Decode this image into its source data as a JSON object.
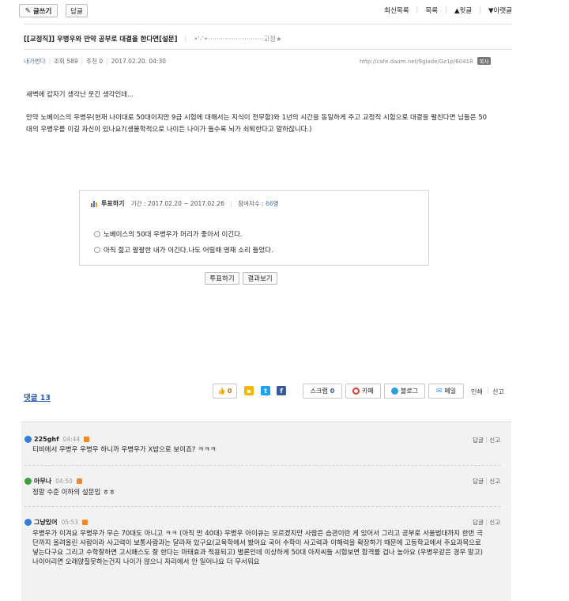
{
  "toolbar": {
    "write_label": "글쓰기",
    "reply_label": "답글"
  },
  "nav": {
    "latest": "최신목록",
    "list": "목록",
    "prev": "▲윗글",
    "next": "▼아랫글"
  },
  "post": {
    "title": "[[교정직]] 우병우와 만약 공부로 대결을 한다면[설문]",
    "title_deco": "•'-'•··························교정★",
    "author": "내가쩐다",
    "views": "조회 589",
    "recommend": "추천 0",
    "date": "2017.02.20. 04:30",
    "url": "http://cafe.daum.net/9glade/Gz1p/60418",
    "copy_label": "복사",
    "body_line1": "새벽에 갑자기 생각난 웃긴 생각인데...",
    "body_para2": "만약 노베이스의 우병우(현재 나이대로 50대이지만 9급 시험에 대해서는 지식이 전무함)와 1년의 시간을 동일하게 주고 교정직 시험으로 대결을 펼친다면 님들은 50대의 우병우를 이길 자신이 있나요?(생물학적으로 나이든 나이가 들수록 뇌가 쇠퇴한다고 말하잖니다.)"
  },
  "poll": {
    "title": "투표하기",
    "period": "기간 : 2017.02.20 ~ 2017.02.26",
    "participants_label": "참여자수 :",
    "participants": "66",
    "participants_unit": "명",
    "options": [
      "노베이스의 50대 우병우가 머리가 좋아서 이긴다.",
      "아직 젊고 팔팔한 내가 이긴다.나도 어릴때 영재 소리 들었다."
    ],
    "vote_button": "투표하기",
    "result_button": "결과보기"
  },
  "comments_header": "댓글 13",
  "share": {
    "like_count": "0",
    "scrap_label": "스크랩",
    "scrap_count": "0",
    "cafe_label": "카페",
    "blog_label": "블로그",
    "mail_label": "메일",
    "print_label": "인쇄",
    "report_label": "신고"
  },
  "comments": [
    {
      "author": "225ghf",
      "time": "04:44",
      "text": "티비에서 우병우 우병우 하니까 우병우가 X밥으로 보이죠? ㅋㅋㅋ",
      "reply": "답글",
      "report": "신고",
      "icon_color": "#2f7fd6"
    },
    {
      "author": "아무나",
      "time": "04:50",
      "text": "정말 수준 이하의 설문임 ㅎㅎ",
      "reply": "답글",
      "report": "신고",
      "icon_color": "#3aa23a"
    },
    {
      "author": "그냥있어",
      "time": "05:53",
      "text": "우병우가 이겨요 우병우가 무슨 70대도 아니고 ㅋㅋ (아직 만 40대) 우병우 아이큐는 모르겠지만 사람은 습관이란 게 있어서 그리고 공부로 서울법대까지 한번 극단까지 올려올린 사람이라 사고력이 보통사람과는 달라져 있구요(교육학에서 봤어요 국어 수학이 사고력과 이해력을 확장하기 때문에 고등학교에서 주요과목으로 넣는다구요 그리고 수학잘하면 고시패스도 잘 한다는 마태효과 적용되고) 별론인데 이상하게 50대 아저씨들 시험보면 합격률 겁나 높아요 (우병우같은 경우 말고)나이어리면 오래앉질못하는건지 나이가 많으니 자리에서 안 일어나요 더 무서워요",
      "reply": "답글",
      "report": "신고",
      "icon_color": "#2f7fd6"
    }
  ]
}
